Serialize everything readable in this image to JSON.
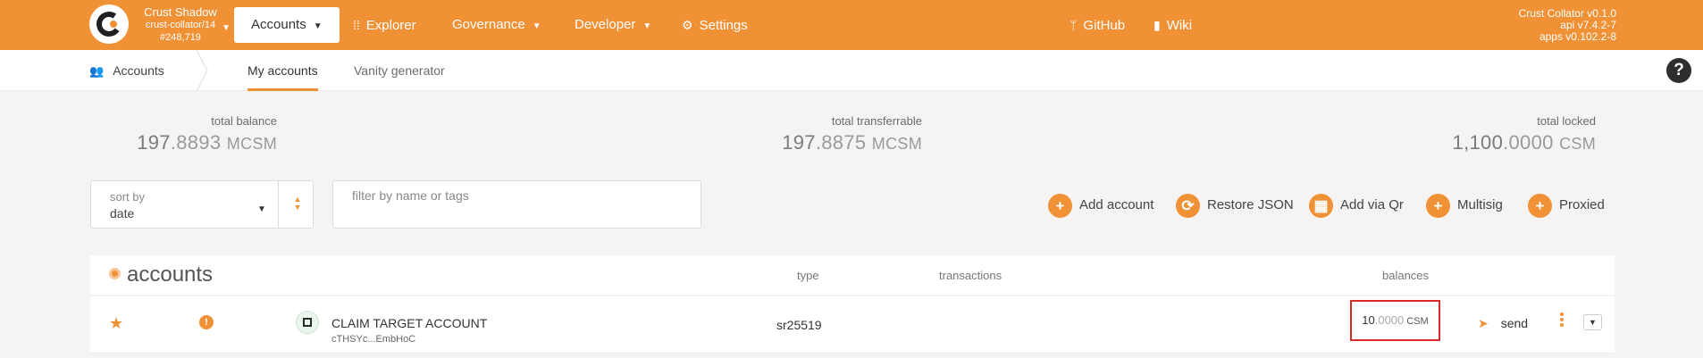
{
  "topbar": {
    "chain_name": "Crust Shadow",
    "node": "crust-collator/14",
    "block": "#248,719",
    "menu": [
      {
        "label": "Accounts",
        "active": true
      },
      {
        "label": "Explorer"
      },
      {
        "label": "Governance"
      },
      {
        "label": "Developer"
      },
      {
        "label": "Settings"
      },
      {
        "label": "GitHub"
      },
      {
        "label": "Wiki"
      }
    ],
    "version": {
      "node": "Crust Collator v0.1.0",
      "api": "api v7.4.2-7",
      "apps": "apps v0.102.2-8"
    },
    "accent_color": "#f19135"
  },
  "subnav": {
    "section": "Accounts",
    "tabs": [
      "My accounts",
      "Vanity generator"
    ],
    "active_tab": "My accounts"
  },
  "summary": {
    "total_balance": {
      "label": "total balance",
      "int": "197",
      "dec": ".8893",
      "unit": "MCSM"
    },
    "total_transferrable": {
      "label": "total transferrable",
      "int": "197",
      "dec": ".8875",
      "unit": "MCSM"
    },
    "total_locked": {
      "label": "total locked",
      "int": "1,100",
      "dec": ".0000",
      "unit": "CSM"
    }
  },
  "controls": {
    "sort_label": "sort by",
    "sort_value": "date",
    "filter_placeholder": "filter by name or tags",
    "actions": [
      "Add account",
      "Restore JSON",
      "Add via Qr",
      "Multisig",
      "Proxied"
    ]
  },
  "table": {
    "title": "accounts",
    "columns": {
      "type": "type",
      "transactions": "transactions",
      "balances": "balances"
    },
    "rows": [
      {
        "name": "CLAIM TARGET ACCOUNT",
        "address": "cTHSYc...EmbHoC",
        "type": "sr25519",
        "transactions": "",
        "balance_int": "10",
        "balance_dec": ".0000",
        "balance_unit": "CSM",
        "send_label": "send"
      }
    ]
  }
}
